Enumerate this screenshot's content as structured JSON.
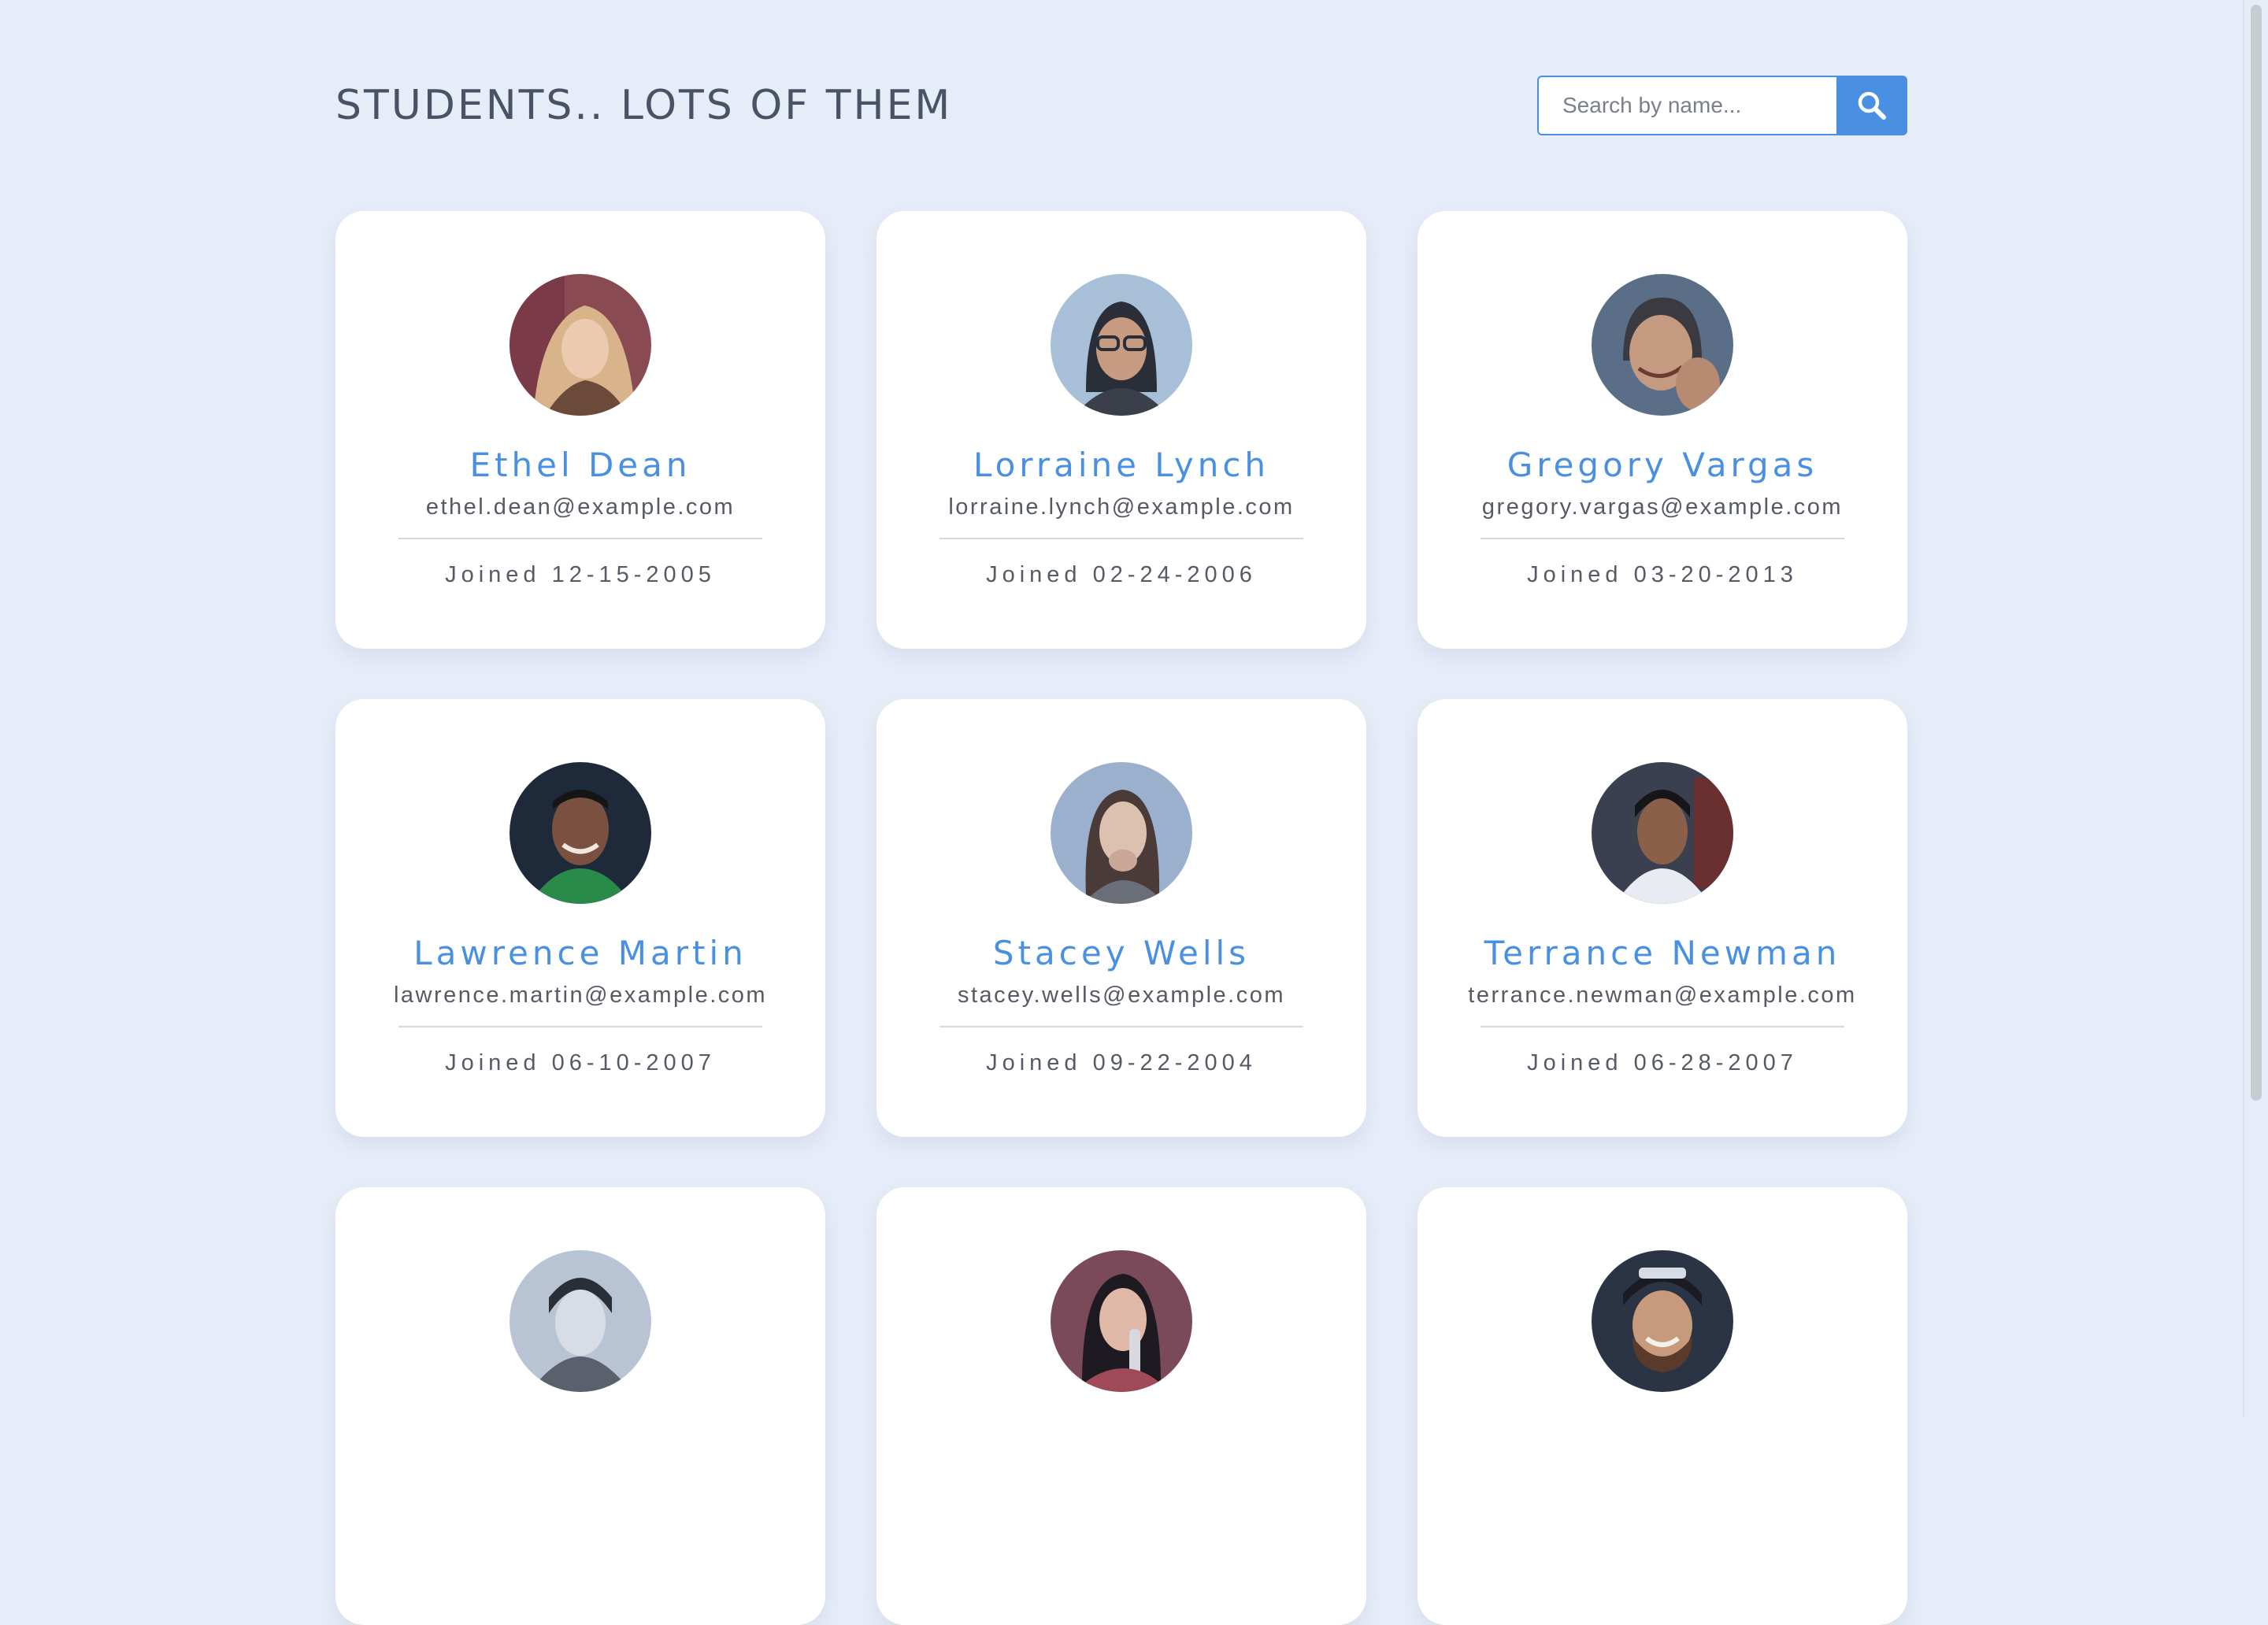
{
  "header": {
    "title": "STUDENTS.. LOTS OF THEM"
  },
  "search": {
    "placeholder": "Search by name...",
    "button_icon": "search-icon"
  },
  "colors": {
    "background": "#e6edf8",
    "accent": "#4a90e2",
    "card": "#ffffff",
    "title": "#4a5266"
  },
  "students": [
    {
      "name": "Ethel Dean",
      "email": "ethel.dean@example.com",
      "joined": "Joined 12-15-2005",
      "avatar": "avatar-photo-1"
    },
    {
      "name": "Lorraine Lynch",
      "email": "lorraine.lynch@example.com",
      "joined": "Joined 02-24-2006",
      "avatar": "avatar-photo-2"
    },
    {
      "name": "Gregory Vargas",
      "email": "gregory.vargas@example.com",
      "joined": "Joined 03-20-2013",
      "avatar": "avatar-photo-3"
    },
    {
      "name": "Lawrence Martin",
      "email": "lawrence.martin@example.com",
      "joined": "Joined 06-10-2007",
      "avatar": "avatar-photo-4"
    },
    {
      "name": "Stacey Wells",
      "email": "stacey.wells@example.com",
      "joined": "Joined 09-22-2004",
      "avatar": "avatar-photo-5"
    },
    {
      "name": "Terrance Newman",
      "email": "terrance.newman@example.com",
      "joined": "Joined 06-28-2007",
      "avatar": "avatar-photo-6"
    },
    {
      "name": "",
      "email": "",
      "joined": "",
      "avatar": "avatar-photo-7"
    },
    {
      "name": "",
      "email": "",
      "joined": "",
      "avatar": "avatar-photo-8"
    },
    {
      "name": "",
      "email": "",
      "joined": "",
      "avatar": "avatar-photo-9"
    }
  ]
}
